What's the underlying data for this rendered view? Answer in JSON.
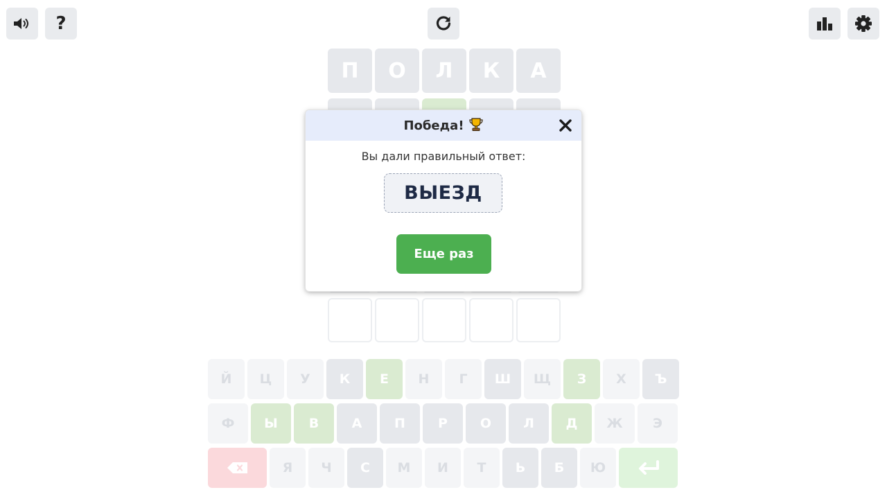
{
  "toolbar": {
    "sound_icon": "speaker-icon",
    "help_label": "?",
    "restart_icon": "refresh-icon",
    "stats_icon": "bar-chart-icon",
    "settings_icon": "gear-icon"
  },
  "board": {
    "rows": [
      {
        "letters": [
          "П",
          "О",
          "Л",
          "К",
          "А"
        ],
        "states": [
          "absent",
          "absent",
          "absent",
          "absent",
          "absent"
        ]
      },
      {
        "letters": [
          "",
          "",
          "",
          "",
          ""
        ],
        "states": [
          "absent",
          "absent",
          "correct",
          "absent",
          "absent"
        ]
      },
      {
        "letters": [
          "",
          "",
          "",
          "",
          ""
        ],
        "states": [
          "empty",
          "empty",
          "empty",
          "empty",
          "empty"
        ]
      },
      {
        "letters": [
          "",
          "",
          "",
          "",
          ""
        ],
        "states": [
          "empty",
          "empty",
          "empty",
          "empty",
          "empty"
        ]
      },
      {
        "letters": [
          "",
          "",
          "",
          "",
          ""
        ],
        "states": [
          "empty",
          "empty",
          "empty",
          "empty",
          "empty"
        ]
      },
      {
        "letters": [
          "",
          "",
          "",
          "",
          ""
        ],
        "states": [
          "empty",
          "empty",
          "empty",
          "empty",
          "empty"
        ]
      }
    ]
  },
  "keyboard": {
    "rows": [
      [
        {
          "label": "Й",
          "state": "unused"
        },
        {
          "label": "Ц",
          "state": "unused"
        },
        {
          "label": "У",
          "state": "unused"
        },
        {
          "label": "К",
          "state": "absent"
        },
        {
          "label": "Е",
          "state": "correct"
        },
        {
          "label": "Н",
          "state": "unused"
        },
        {
          "label": "Г",
          "state": "unused"
        },
        {
          "label": "Ш",
          "state": "absent"
        },
        {
          "label": "Щ",
          "state": "unused"
        },
        {
          "label": "З",
          "state": "correct"
        },
        {
          "label": "Х",
          "state": "unused"
        },
        {
          "label": "Ъ",
          "state": "absent"
        }
      ],
      [
        {
          "label": "Ф",
          "state": "unused"
        },
        {
          "label": "Ы",
          "state": "correct"
        },
        {
          "label": "В",
          "state": "correct"
        },
        {
          "label": "А",
          "state": "absent"
        },
        {
          "label": "П",
          "state": "absent"
        },
        {
          "label": "Р",
          "state": "absent"
        },
        {
          "label": "О",
          "state": "absent"
        },
        {
          "label": "Л",
          "state": "absent"
        },
        {
          "label": "Д",
          "state": "correct"
        },
        {
          "label": "Ж",
          "state": "unused"
        },
        {
          "label": "Э",
          "state": "unused"
        }
      ],
      [
        {
          "label": "",
          "state": "delete",
          "icon": "backspace-icon"
        },
        {
          "label": "Я",
          "state": "unused"
        },
        {
          "label": "Ч",
          "state": "unused"
        },
        {
          "label": "С",
          "state": "absent"
        },
        {
          "label": "М",
          "state": "unused"
        },
        {
          "label": "И",
          "state": "unused"
        },
        {
          "label": "Т",
          "state": "unused"
        },
        {
          "label": "Ь",
          "state": "absent"
        },
        {
          "label": "Б",
          "state": "absent"
        },
        {
          "label": "Ю",
          "state": "unused"
        },
        {
          "label": "",
          "state": "enter",
          "icon": "enter-icon"
        }
      ]
    ]
  },
  "modal": {
    "title": "Победа!",
    "title_icon": "trophy-icon",
    "close_icon": "close-icon",
    "message": "Вы дали правильный ответ:",
    "answer": "ВЫЕЗД",
    "again_label": "Еще раз"
  },
  "colors": {
    "correct": "#daebd1",
    "absent": "#e6e8ec",
    "primary_button": "#4caf50",
    "modal_header": "#e6ecfb"
  }
}
